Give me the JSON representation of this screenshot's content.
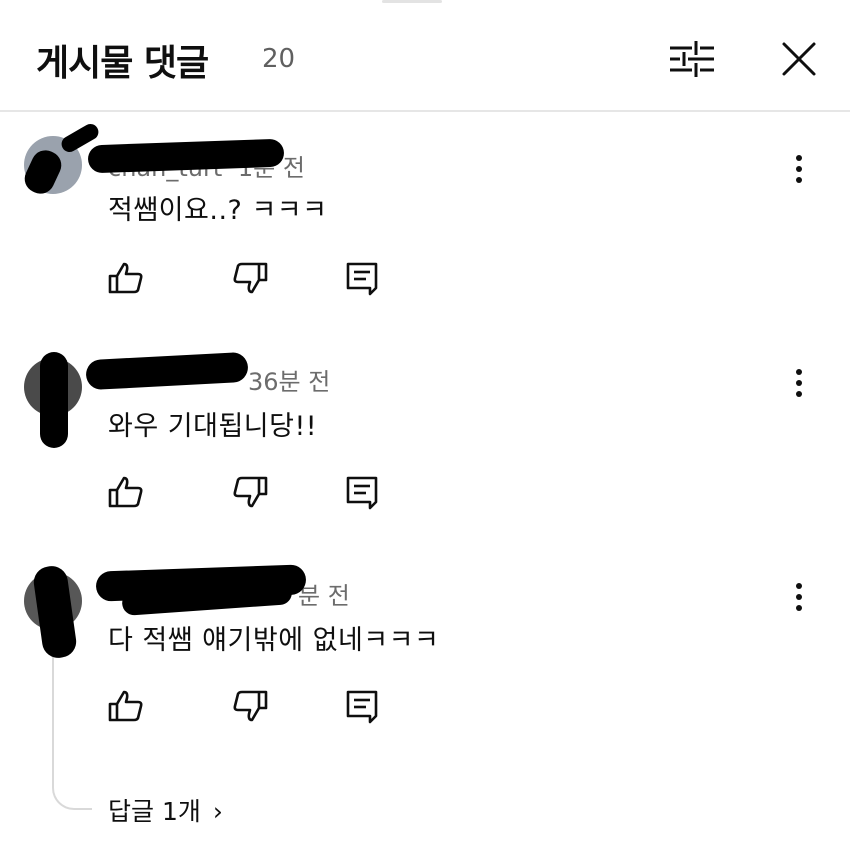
{
  "header": {
    "title": "게시물 댓글",
    "count": "20"
  },
  "comments": [
    {
      "author": "chan_turt",
      "time": "1분 전",
      "text": "적쌤이요..? ㅋㅋㅋ"
    },
    {
      "author": "",
      "time": "36분 전",
      "text": "와우 기대됩니당!!"
    },
    {
      "author": "",
      "time": "분 전",
      "text": "다 적쌤 얘기밖에 없네ㅋㅋㅋ",
      "replies": "답글 1개"
    }
  ],
  "icons": {
    "filter": "sliders-icon",
    "close": "close-icon",
    "more": "more-vertical-icon",
    "like": "thumb-up-icon",
    "dislike": "thumb-down-icon",
    "reply": "reply-icon",
    "chevron": "chevron-right-icon"
  },
  "colors": {
    "text": "#0f0f0f",
    "muted": "#606060",
    "divider": "#e6e6e6"
  }
}
